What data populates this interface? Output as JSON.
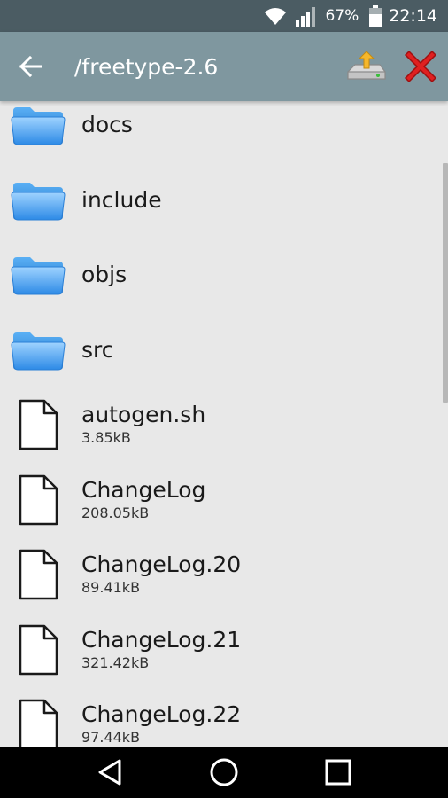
{
  "status_bar": {
    "battery_percent": "67%",
    "time": "22:14",
    "icons": [
      "wifi-icon",
      "signal-icon",
      "battery-icon"
    ]
  },
  "app_bar": {
    "title": "/freetype-2.6",
    "back_icon": "back-arrow-icon",
    "actions": [
      "install-icon",
      "close-icon"
    ]
  },
  "files": [
    {
      "name": "docs",
      "type": "folder",
      "size": ""
    },
    {
      "name": "include",
      "type": "folder",
      "size": ""
    },
    {
      "name": "objs",
      "type": "folder",
      "size": ""
    },
    {
      "name": "src",
      "type": "folder",
      "size": ""
    },
    {
      "name": "autogen.sh",
      "type": "file",
      "size": "3.85kB"
    },
    {
      "name": "ChangeLog",
      "type": "file",
      "size": "208.05kB"
    },
    {
      "name": "ChangeLog.20",
      "type": "file",
      "size": "89.41kB"
    },
    {
      "name": "ChangeLog.21",
      "type": "file",
      "size": "321.42kB"
    },
    {
      "name": "ChangeLog.22",
      "type": "file",
      "size": "97.44kB"
    }
  ],
  "nav_bar": {
    "buttons": [
      "back-triangle-icon",
      "home-circle-icon",
      "recents-square-icon"
    ]
  },
  "colors": {
    "status_bar": "#4b5c63",
    "app_bar": "#7f979f",
    "background": "#e8e8e8",
    "folder_blue": "#4aa3f0",
    "close_red": "#e02020"
  }
}
